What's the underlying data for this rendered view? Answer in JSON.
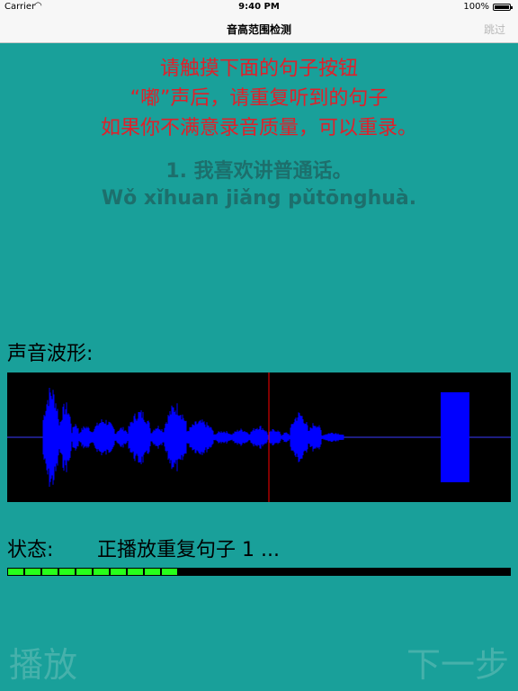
{
  "status_bar": {
    "carrier": "Carrier",
    "time": "9:40 PM",
    "battery": "100%"
  },
  "nav": {
    "title": "音高范围检测",
    "skip_label": "跳过"
  },
  "instructions": [
    "请触摸下面的句子按钮",
    "“嘟”声后，请重复听到的句子",
    "如果你不满意录音质量，可以重录。"
  ],
  "sentence": {
    "hanzi": "1. 我喜欢讲普通话。",
    "pinyin": "Wǒ xǐhuan jiǎng pǔtōnghuà."
  },
  "waveform": {
    "label": "声音波形:",
    "background_color": "#000000",
    "wave_color": "#0000ff",
    "axis_color": "#3a3aff",
    "cursor_color": "#ff0000",
    "playhead_fraction": 0.52
  },
  "status": {
    "label": "状态:",
    "value": "正播放重复句子 1 ..."
  },
  "progress": {
    "fraction": 0.37,
    "fill_color": "#27ff1a"
  },
  "buttons": {
    "play": "播放",
    "next": "下一步"
  }
}
